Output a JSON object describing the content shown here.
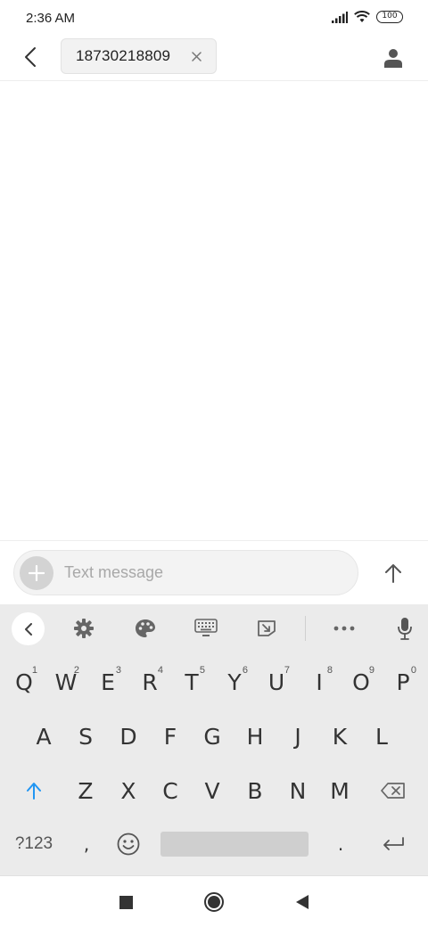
{
  "status_bar": {
    "time": "2:36 AM",
    "battery": "100",
    "icons": [
      "signal-icon",
      "wifi-icon",
      "battery-icon"
    ]
  },
  "header": {
    "recipient": "18730218809",
    "icons": [
      "back-arrow-icon",
      "close-icon",
      "contact-icon"
    ]
  },
  "compose": {
    "placeholder": "Text message",
    "value": "",
    "icons": [
      "plus-icon",
      "send-arrow-icon"
    ]
  },
  "keyboard": {
    "toolbar": [
      "chevron-left-icon",
      "gear-icon",
      "palette-icon",
      "keyboard-icon",
      "resize-icon",
      "more-dots-icon",
      "microphone-icon"
    ],
    "row1": [
      {
        "label": "Q",
        "hint": "1"
      },
      {
        "label": "W",
        "hint": "2"
      },
      {
        "label": "E",
        "hint": "3"
      },
      {
        "label": "R",
        "hint": "4"
      },
      {
        "label": "T",
        "hint": "5"
      },
      {
        "label": "Y",
        "hint": "6"
      },
      {
        "label": "U",
        "hint": "7"
      },
      {
        "label": "I",
        "hint": "8"
      },
      {
        "label": "O",
        "hint": "9"
      },
      {
        "label": "P",
        "hint": "0"
      }
    ],
    "row2": [
      "A",
      "S",
      "D",
      "F",
      "G",
      "H",
      "J",
      "K",
      "L"
    ],
    "row3": [
      "Z",
      "X",
      "C",
      "V",
      "B",
      "N",
      "M"
    ],
    "symbols_label": "?123",
    "comma": ",",
    "period": ".",
    "accent_color": "#2196f3"
  },
  "nav_bar": {
    "icons": [
      "recents-square-icon",
      "home-circle-icon",
      "back-triangle-icon"
    ]
  }
}
